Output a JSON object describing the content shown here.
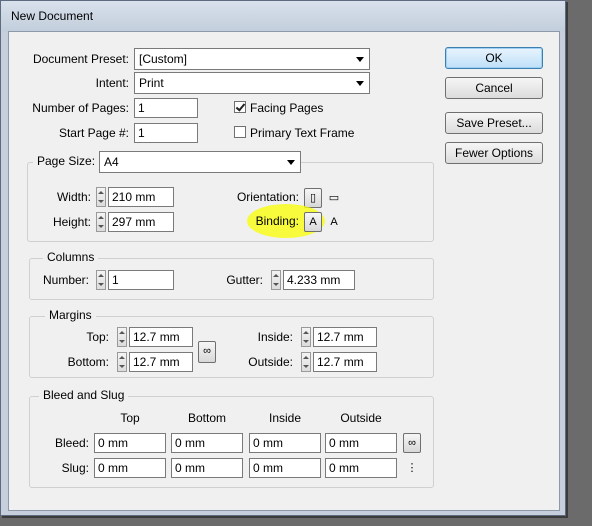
{
  "window": {
    "title": "New Document"
  },
  "document_preset": {
    "label": "Document Preset:",
    "value": "[Custom]"
  },
  "intent": {
    "label": "Intent:",
    "value": "Print"
  },
  "number_of_pages": {
    "label": "Number of Pages:",
    "value": "1"
  },
  "start_page": {
    "label": "Start Page #:",
    "value": "1"
  },
  "facing_pages": {
    "label": "Facing Pages",
    "checked": true
  },
  "primary_text_frame": {
    "label": "Primary Text Frame",
    "checked": false
  },
  "buttons": {
    "ok": "OK",
    "cancel": "Cancel",
    "save_preset": "Save Preset...",
    "fewer_options": "Fewer Options"
  },
  "page_size": {
    "label": "Page Size:",
    "value": "A4",
    "width_label": "Width:",
    "width": "210 mm",
    "height_label": "Height:",
    "height": "297 mm",
    "orientation_label": "Orientation:",
    "binding_label": "Binding:",
    "highlight_color": "#f8ff00"
  },
  "columns": {
    "title": "Columns",
    "number_label": "Number:",
    "number": "1",
    "gutter_label": "Gutter:",
    "gutter": "4.233 mm"
  },
  "margins": {
    "title": "Margins",
    "top_label": "Top:",
    "top": "12.7 mm",
    "bottom_label": "Bottom:",
    "bottom": "12.7 mm",
    "inside_label": "Inside:",
    "inside": "12.7 mm",
    "outside_label": "Outside:",
    "outside": "12.7 mm"
  },
  "bleed_slug": {
    "title": "Bleed and Slug",
    "headers": [
      "Top",
      "Bottom",
      "Inside",
      "Outside"
    ],
    "bleed_label": "Bleed:",
    "bleed": [
      "0 mm",
      "0 mm",
      "0 mm",
      "0 mm"
    ],
    "slug_label": "Slug:",
    "slug": [
      "0 mm",
      "0 mm",
      "0 mm",
      "0 mm"
    ]
  },
  "icons": {
    "portrait": "portrait-orientation-icon",
    "landscape": "landscape-orientation-icon",
    "binding_left": "left-binding-icon",
    "binding_right": "right-binding-icon",
    "chain": "chain-link-icon",
    "broken_chain": "broken-chain-icon"
  }
}
